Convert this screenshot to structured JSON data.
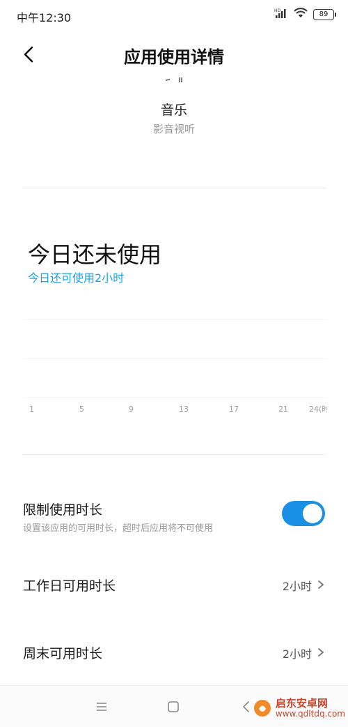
{
  "status_bar": {
    "time": "中午12:30",
    "battery": "89",
    "hd_label": "HD"
  },
  "header": {
    "title": "应用使用详情"
  },
  "app": {
    "name": "音乐",
    "category": "影音视听"
  },
  "usage": {
    "title": "今日还未使用",
    "subtitle": "今日还可使用2小时",
    "accent_color": "#1aa3e8"
  },
  "chart_data": {
    "type": "bar",
    "x_ticks": [
      "1",
      "5",
      "9",
      "13",
      "17",
      "21",
      "24(时)"
    ],
    "values": [],
    "grid": true
  },
  "settings": {
    "limit": {
      "title": "限制使用时长",
      "desc": "设置该应用的可用时长，超时后应用将不可使用",
      "enabled": true,
      "toggle_color": "#1a8fe6"
    },
    "weekday": {
      "title": "工作日可用时长",
      "value": "2小时"
    },
    "weekend": {
      "title": "周末可用时长",
      "value": "2小时"
    }
  },
  "nav": {
    "icons": [
      "menu-icon",
      "home-icon",
      "back-icon"
    ]
  },
  "watermark": {
    "text": "启东安卓网",
    "url": "www.qdltdq.com"
  }
}
